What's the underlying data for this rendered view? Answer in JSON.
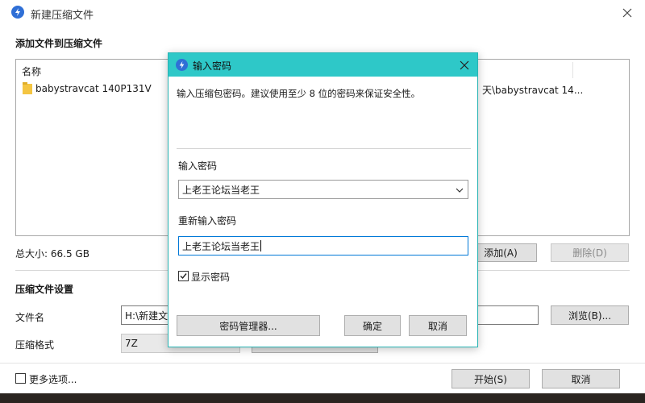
{
  "main": {
    "title": "新建压缩文件",
    "section_files": "添加文件到压缩文件",
    "column_name": "名称",
    "file_name": "babystravcat 140P131V",
    "file_path": "天\\babystravcat 14...",
    "total_size": "总大小: 66.5 GB",
    "add_button": "添加(A)",
    "delete_button": "删除(D)",
    "section_settings": "压缩文件设置",
    "filename_label": "文件名",
    "filename_value": "H:\\新建文",
    "browse_button": "浏览(B)...",
    "format_label": "压缩格式",
    "format_value": "7Z",
    "more_options": "更多选项...",
    "start_button": "开始(S)",
    "cancel_button": "取消"
  },
  "dialog": {
    "title": "输入密码",
    "description": "输入压缩包密码。建议使用至少 8 位的密码来保证安全性。",
    "password_label": "输入密码",
    "password_value": "上老王论坛当老王",
    "reenter_label": "重新输入密码",
    "reenter_value": "上老王论坛当老王",
    "show_password": "显示密码",
    "show_password_checked": true,
    "manager_button": "密码管理器...",
    "ok_button": "确定",
    "cancel_button": "取消"
  },
  "colors": {
    "dialog_titlebar": "#2ec8c8",
    "dialog_border": "#28b4b4",
    "app_icon": "#2f6fd6",
    "focus_border": "#0078d7"
  }
}
